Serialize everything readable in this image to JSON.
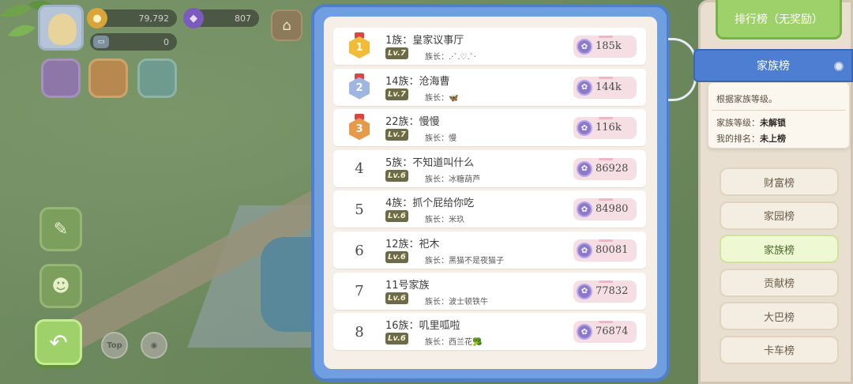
{
  "hud": {
    "gold": "79,792",
    "gems": "807",
    "energy": "0"
  },
  "buttons": {
    "top": "Top",
    "shop_icon": "shop-icon"
  },
  "leaderboard": {
    "rows": [
      {
        "rank": "1",
        "medal": true,
        "name": "1族：皇家议事厅",
        "level": "Lv.7",
        "leader": "族长：.·`.♡.`·",
        "score": "185k"
      },
      {
        "rank": "2",
        "medal": true,
        "name": "14族：沧海曹",
        "level": "Lv.7",
        "leader": "族长：🦋",
        "score": "144k"
      },
      {
        "rank": "3",
        "medal": true,
        "name": "22族：慢慢",
        "level": "Lv.7",
        "leader": "族长：慢",
        "score": "116k"
      },
      {
        "rank": "4",
        "medal": false,
        "name": "5族：不知道叫什么",
        "level": "Lv.6",
        "leader": "族长：冰糖葫芦",
        "score": "86928"
      },
      {
        "rank": "5",
        "medal": false,
        "name": "4族：抓个屁给你吃",
        "level": "Lv.6",
        "leader": "族长：米玖",
        "score": "84980"
      },
      {
        "rank": "6",
        "medal": false,
        "name": "12族：祀木",
        "level": "Lv.6",
        "leader": "族长：黑猫不是夜猫子",
        "score": "80081"
      },
      {
        "rank": "7",
        "medal": false,
        "name": "11号家族",
        "level": "Lv.6",
        "leader": "族长：波士顿铁牛",
        "score": "77832"
      },
      {
        "rank": "8",
        "medal": false,
        "name": "16族：叽里呱啦",
        "level": "Lv.6",
        "leader": "族长：西兰花🥦",
        "score": "76874"
      }
    ]
  },
  "sidebar": {
    "title": "排行榜（无奖励）",
    "active_tab": "家族榜",
    "info": {
      "desc": "根据家族等级。",
      "level_label": "家族等级：",
      "level_value": "未解锁",
      "rank_label": "我的排名：",
      "rank_value": "未上榜"
    },
    "categories": [
      {
        "label": "财富榜",
        "active": false
      },
      {
        "label": "家园榜",
        "active": false
      },
      {
        "label": "家族榜",
        "active": true
      },
      {
        "label": "贡献榜",
        "active": false
      },
      {
        "label": "大巴榜",
        "active": false
      },
      {
        "label": "卡车榜",
        "active": false
      }
    ]
  },
  "colors": {
    "panel_blue": "#6f9fe0",
    "active_tab": "#4d7ed1",
    "green_button": "#9ed16a"
  }
}
